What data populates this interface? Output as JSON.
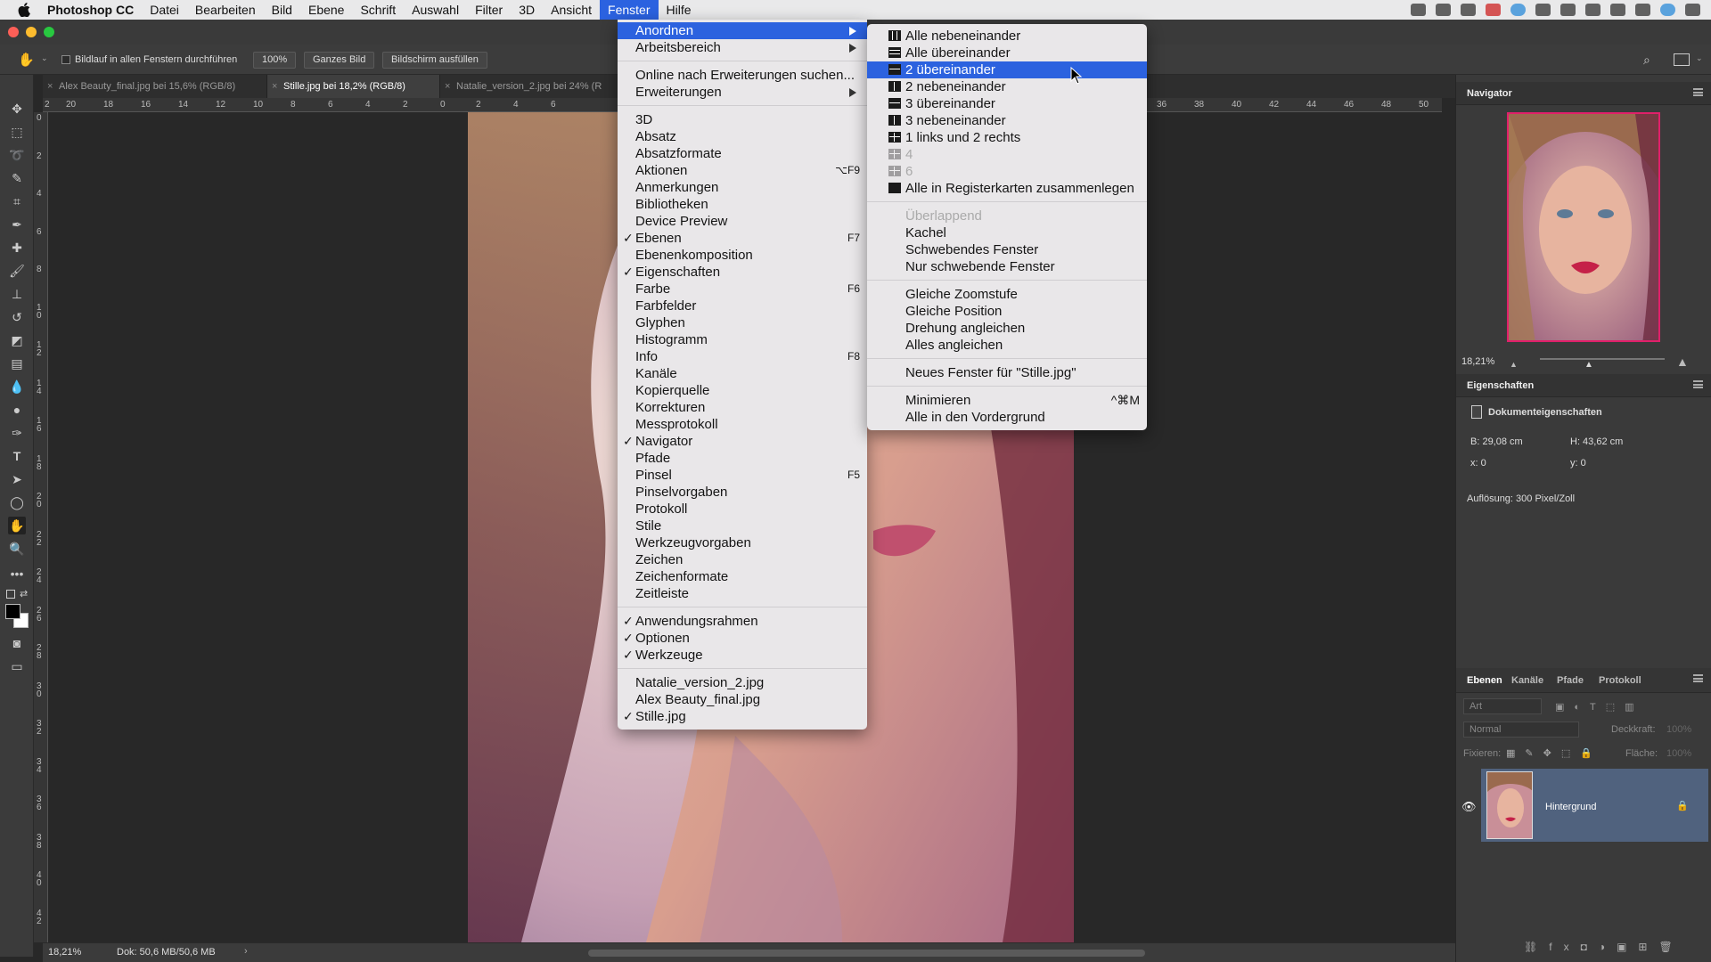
{
  "menubar": {
    "apple": "",
    "items": [
      "Photoshop CC",
      "Datei",
      "Bearbeiten",
      "Bild",
      "Ebene",
      "Schrift",
      "Auswahl",
      "Filter",
      "3D",
      "Ansicht",
      "Fenster",
      "Hilfe"
    ],
    "active": "Fenster"
  },
  "options": {
    "scroll_all": "Bildlauf in allen Fenstern durchführen",
    "zoom": "100%",
    "fit": "Ganzes Bild",
    "fill": "Bildschirm ausfüllen"
  },
  "tabs": [
    {
      "label": "Alex Beauty_final.jpg bei 15,6% (RGB/8)",
      "active": false
    },
    {
      "label": "Stille.jpg bei 18,2% (RGB/8)",
      "active": true
    },
    {
      "label": "Natalie_version_2.jpg bei 24% (R",
      "active": false
    }
  ],
  "ruler_h": [
    "2",
    "20",
    "18",
    "16",
    "14",
    "12",
    "10",
    "8",
    "6",
    "4",
    "2",
    "0",
    "2",
    "4",
    "6",
    "36",
    "38",
    "40",
    "42",
    "44",
    "46",
    "48",
    "50"
  ],
  "ruler_v": [
    "0",
    "2",
    "4",
    "6",
    "8",
    "1 0",
    "1 2",
    "1 4",
    "1 6",
    "1 8",
    "2 0",
    "2 2",
    "2 4",
    "2 6",
    "2 8",
    "3 0",
    "3 2",
    "3 4",
    "3 6",
    "3 8",
    "4 0",
    "4 2"
  ],
  "statusbar": {
    "zoom": "18,21%",
    "doc": "Dok: 50,6 MB/50,6 MB"
  },
  "navigator": {
    "title": "Navigator",
    "zoom": "18,21%"
  },
  "properties": {
    "title": "Eigenschaften",
    "doc_label": "Dokumenteigenschaften",
    "width": "B: 29,08 cm",
    "height": "H: 43,62 cm",
    "x": "x: 0",
    "y": "y: 0",
    "resolution": "Auflösung: 300 Pixel/Zoll"
  },
  "layers": {
    "tabs": [
      "Ebenen",
      "Kanäle",
      "Pfade",
      "Protokoll"
    ],
    "search": "Art",
    "blend": "Normal",
    "opacity_label": "Deckkraft:",
    "opacity_value": "100%",
    "lock_label": "Fixieren:",
    "fill_label": "Fläche:",
    "fill_value": "100%",
    "layer_name": "Hintergrund"
  },
  "fenster_menu": [
    {
      "label": "Anordnen",
      "submenu": true,
      "highlight": true
    },
    {
      "label": "Arbeitsbereich",
      "submenu": true
    },
    {
      "sep": true
    },
    {
      "label": "Online nach Erweiterungen suchen..."
    },
    {
      "label": "Erweiterungen",
      "submenu": true
    },
    {
      "sep": true
    },
    {
      "label": "3D"
    },
    {
      "label": "Absatz"
    },
    {
      "label": "Absatzformate"
    },
    {
      "label": "Aktionen",
      "shortcut": "⌥F9"
    },
    {
      "label": "Anmerkungen"
    },
    {
      "label": "Bibliotheken"
    },
    {
      "label": "Device Preview"
    },
    {
      "label": "Ebenen",
      "shortcut": "F7",
      "checked": true
    },
    {
      "label": "Ebenenkomposition"
    },
    {
      "label": "Eigenschaften",
      "checked": true
    },
    {
      "label": "Farbe",
      "shortcut": "F6"
    },
    {
      "label": "Farbfelder"
    },
    {
      "label": "Glyphen"
    },
    {
      "label": "Histogramm"
    },
    {
      "label": "Info",
      "shortcut": "F8"
    },
    {
      "label": "Kanäle"
    },
    {
      "label": "Kopierquelle"
    },
    {
      "label": "Korrekturen"
    },
    {
      "label": "Messprotokoll"
    },
    {
      "label": "Navigator",
      "checked": true
    },
    {
      "label": "Pfade"
    },
    {
      "label": "Pinsel",
      "shortcut": "F5"
    },
    {
      "label": "Pinselvorgaben"
    },
    {
      "label": "Protokoll"
    },
    {
      "label": "Stile"
    },
    {
      "label": "Werkzeugvorgaben"
    },
    {
      "label": "Zeichen"
    },
    {
      "label": "Zeichenformate"
    },
    {
      "label": "Zeitleiste"
    },
    {
      "sep": true
    },
    {
      "label": "Anwendungsrahmen",
      "checked": true
    },
    {
      "label": "Optionen",
      "checked": true
    },
    {
      "label": "Werkzeuge",
      "checked": true
    },
    {
      "sep": true
    },
    {
      "label": "Natalie_version_2.jpg"
    },
    {
      "label": "Alex Beauty_final.jpg"
    },
    {
      "label": "Stille.jpg",
      "checked": true
    }
  ],
  "anordnen_menu": [
    {
      "label": "Alle nebeneinander",
      "icon": "v4"
    },
    {
      "label": "Alle übereinander",
      "icon": "h4"
    },
    {
      "label": "2 übereinander",
      "icon": "h2",
      "highlight": true
    },
    {
      "label": "2 nebeneinander",
      "icon": "v2"
    },
    {
      "label": "3 übereinander",
      "icon": "h3"
    },
    {
      "label": "3 nebeneinander",
      "icon": "v3"
    },
    {
      "label": "1 links und 2 rechts",
      "icon": "grid"
    },
    {
      "label": "4",
      "icon": "grid",
      "disabled": true
    },
    {
      "label": "6",
      "icon": "grid",
      "disabled": true
    },
    {
      "label": "Alle in Registerkarten zusammenlegen",
      "icon": "solid"
    },
    {
      "sep": true
    },
    {
      "label": "Überlappend",
      "disabled": true
    },
    {
      "label": "Kachel"
    },
    {
      "label": "Schwebendes Fenster"
    },
    {
      "label": "Nur schwebende Fenster"
    },
    {
      "sep": true
    },
    {
      "label": "Gleiche Zoomstufe"
    },
    {
      "label": "Gleiche Position"
    },
    {
      "label": "Drehung angleichen"
    },
    {
      "label": "Alles angleichen"
    },
    {
      "sep": true
    },
    {
      "label": "Neues Fenster für \"Stille.jpg\""
    },
    {
      "sep": true
    },
    {
      "label": "Minimieren",
      "shortcut": "^⌘M"
    },
    {
      "label": "Alle in den Vordergrund"
    }
  ]
}
